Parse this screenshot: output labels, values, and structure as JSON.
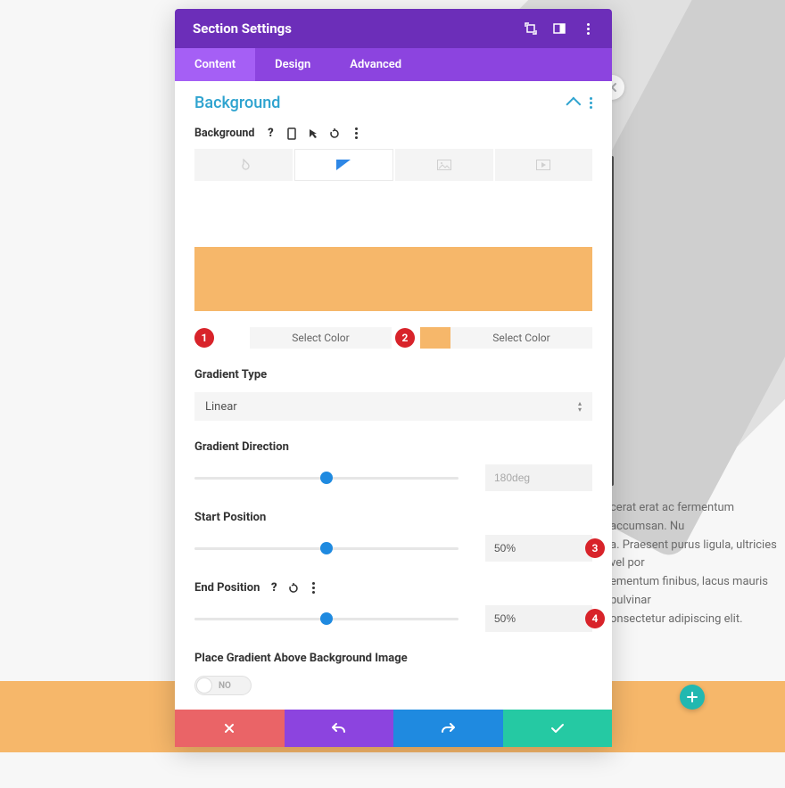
{
  "header": {
    "title": "Section Settings"
  },
  "tabs": {
    "content": "Content",
    "design": "Design",
    "advanced": "Advanced"
  },
  "section": {
    "title": "Background",
    "bg_label": "Background"
  },
  "colors": {
    "select1": "Select Color",
    "select2": "Select Color",
    "swatch1": "#ffffff",
    "swatch2": "#f6b76a"
  },
  "gradient_type": {
    "label": "Gradient Type",
    "value": "Linear"
  },
  "gradient_direction": {
    "label": "Gradient Direction",
    "value": "180deg"
  },
  "start_position": {
    "label": "Start Position",
    "value": "50%"
  },
  "end_position": {
    "label": "End Position",
    "value": "50%"
  },
  "place_above": {
    "label": "Place Gradient Above Background Image",
    "value": "NO"
  },
  "markers": {
    "m1": "1",
    "m2": "2",
    "m3": "3",
    "m4": "4"
  },
  "bg_text": "cerat erat ac fermentum accumsan. Nu\na. Praesent purus ligula, ultricies vel por\nementum finibus, lacus mauris pulvinar\nonsectetur adipiscing elit."
}
